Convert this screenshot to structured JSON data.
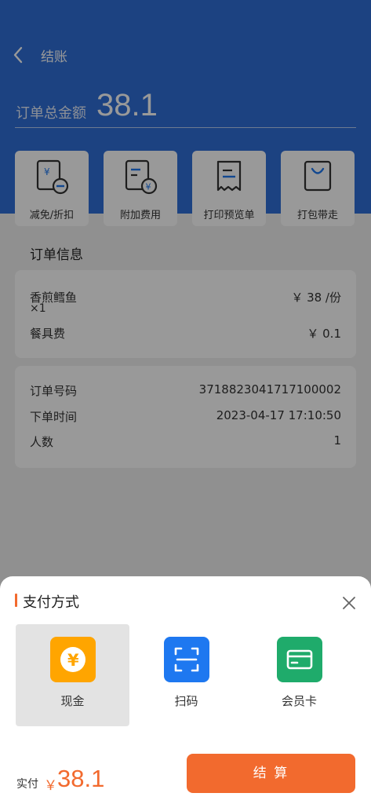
{
  "header": {
    "title": "结账"
  },
  "total": {
    "label": "订单总金额",
    "value": "38.1"
  },
  "actions": [
    {
      "label": "减免/折扣",
      "icon": "discount-icon"
    },
    {
      "label": "附加费用",
      "icon": "extra-fee-icon"
    },
    {
      "label": "打印预览单",
      "icon": "print-receipt-icon"
    },
    {
      "label": "打包带走",
      "icon": "takeaway-bag-icon"
    }
  ],
  "order_info": {
    "title": "订单信息",
    "items": [
      {
        "name": "香煎鳕鱼",
        "qty": "×1",
        "price": "￥ 38 /份"
      },
      {
        "name": "餐具费",
        "price": "￥ 0.1"
      }
    ],
    "details": [
      {
        "label": "订单号码",
        "value": "3718823041717100002"
      },
      {
        "label": "下单时间",
        "value": "2023-04-17 17:10:50"
      },
      {
        "label": "人数",
        "value": "1"
      }
    ]
  },
  "payment": {
    "title": "支付方式",
    "options": [
      {
        "label": "现金",
        "icon": "cash-yen-icon",
        "color": "#ffa500",
        "selected": true
      },
      {
        "label": "扫码",
        "icon": "scan-qr-icon",
        "color": "#1e78f0",
        "selected": false
      },
      {
        "label": "会员卡",
        "icon": "member-card-icon",
        "color": "#1fab6b",
        "selected": false
      }
    ],
    "actual_label": "实付",
    "currency": "￥",
    "actual_amount": "38.1",
    "checkout_label": "结 算"
  },
  "colors": {
    "header_blue": "#2f6fd8",
    "accent_orange": "#f26a2e",
    "cash_yellow": "#ffa500",
    "scan_blue": "#1e78f0",
    "member_green": "#1fab6b"
  }
}
